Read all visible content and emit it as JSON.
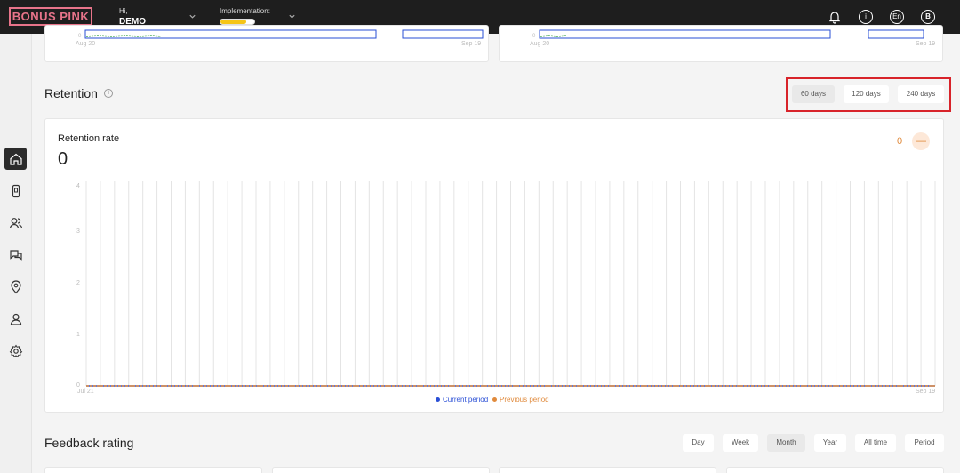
{
  "header": {
    "logo": "BONUS PINK",
    "greeting": "Hi,",
    "username": "DEMO",
    "implementation_label": "Implementation:",
    "implementation_progress": 0.75,
    "language": "En",
    "avatar_initial": "B"
  },
  "sidebar": {
    "items": [
      {
        "icon": "home-icon",
        "active": true
      },
      {
        "icon": "mobile-icon",
        "active": false
      },
      {
        "icon": "users-icon",
        "active": false
      },
      {
        "icon": "chat-icon",
        "active": false
      },
      {
        "icon": "location-icon",
        "active": false
      },
      {
        "icon": "user-icon",
        "active": false
      },
      {
        "icon": "gear-icon",
        "active": false
      }
    ]
  },
  "top_cards": [
    {
      "x_start": "Aug 20",
      "x_end": "Sep 19"
    },
    {
      "x_start": "Aug 20",
      "x_end": "Sep 19"
    }
  ],
  "retention": {
    "title": "Retention",
    "ranges": [
      "60 days",
      "120 days",
      "240 days"
    ],
    "active_range": "60 days",
    "rate_label": "Retention rate",
    "rate_value": "0",
    "previous_value": "0",
    "previous_toggle": "—",
    "legend_current": "Current period",
    "legend_previous": "Previous period",
    "colors": {
      "current": "#2a4fd6",
      "previous": "#e08a3c"
    }
  },
  "chart_data": {
    "type": "line",
    "x_start": "Jul 21",
    "x_end": "Sep 19",
    "y_ticks": [
      "4",
      "3",
      "2",
      "1",
      "0"
    ],
    "ylim": [
      0,
      4
    ],
    "series": [
      {
        "name": "Current period",
        "values": [
          0
        ]
      },
      {
        "name": "Previous period",
        "values": [
          0
        ]
      }
    ]
  },
  "feedback": {
    "title": "Feedback rating",
    "periods": [
      "Day",
      "Week",
      "Month",
      "Year",
      "All time",
      "Period"
    ],
    "active_period": "Month"
  }
}
